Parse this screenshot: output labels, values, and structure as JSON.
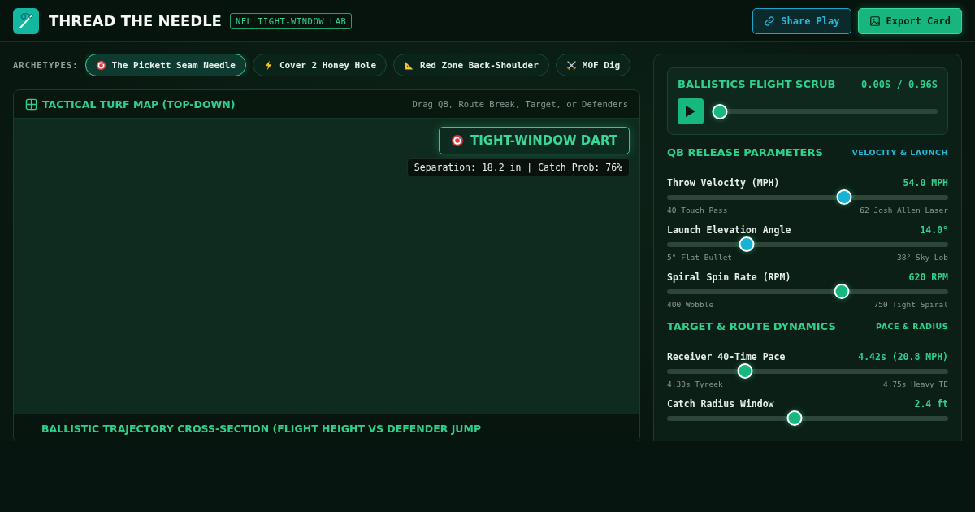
{
  "app": {
    "title": "THREAD THE NEEDLE",
    "badge": "NFL TIGHT-WINDOW LAB"
  },
  "actions": [
    {
      "label": "Share Play",
      "kind": "share"
    },
    {
      "label": "Export Card",
      "kind": "export"
    }
  ],
  "archetypes": {
    "label": "ARCHETYPES:",
    "items": [
      {
        "label": "The Pickett Seam Needle",
        "selected": true
      },
      {
        "label": "Cover 2 Honey Hole",
        "selected": false
      },
      {
        "label": "Red Zone Back-Shoulder",
        "selected": false
      },
      {
        "label": "MOF Dig",
        "selected": false
      }
    ]
  },
  "turf_map": {
    "title": "TACTICAL TURF MAP (TOP-DOWN)",
    "hint": "Drag QB, Route Break, Target, or Defenders",
    "verdict": "TIGHT-WINDOW DART",
    "stats": "Separation: 18.2 in | Catch Prob: 76%"
  },
  "trajectory": {
    "title": "BALLISTIC TRAJECTORY CROSS-SECTION (FLIGHT HEIGHT VS DEFENDER JUMP"
  },
  "scrub": {
    "title": "BALLISTICS FLIGHT SCRUB",
    "time": "0.00S / 0.96S",
    "level": 0.0
  },
  "sections": [
    {
      "title": "QB RELEASE PARAMETERS",
      "tag": "VELOCITY & LAUNCH",
      "color": "#22b8d8",
      "sliders": [
        {
          "label": "Throw Velocity (MPH)",
          "reading": "54.0 MPH",
          "level": 0.63,
          "color": "#16b3d6",
          "min": "40 Touch Pass",
          "max": "62 Josh Allen Laser"
        },
        {
          "label": "Launch Elevation Angle",
          "reading": "14.0°",
          "level": 0.283,
          "color": "#16b3d6",
          "min": "5° Flat Bullet",
          "max": "38° Sky Lob"
        },
        {
          "label": "Spiral Spin Rate (RPM)",
          "reading": "620 RPM",
          "level": 0.62,
          "color": "#17b87e",
          "min": "400 Wobble",
          "max": "750 Tight Spiral"
        }
      ]
    },
    {
      "title": "TARGET & ROUTE DYNAMICS",
      "tag": "PACE & RADIUS",
      "color": "#2fd08f",
      "sliders": [
        {
          "label": "Receiver 40-Time Pace",
          "reading": "4.42s (20.8 MPH)",
          "level": 0.277,
          "color": "#17b87e",
          "min": "4.30s Tyreek",
          "max": "4.75s Heavy TE"
        },
        {
          "label": "Catch Radius Window",
          "reading": "2.4 ft",
          "level": 0.454,
          "color": "#17b87e"
        }
      ]
    }
  ]
}
